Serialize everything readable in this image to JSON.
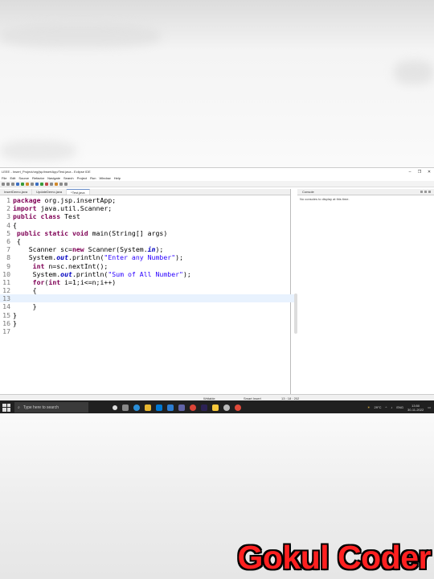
{
  "window": {
    "title": "LEEE - Insert_Project/org/jsp/insertApp/Test.java - Eclipse IDE",
    "controls": [
      "–",
      "❐",
      "✕"
    ]
  },
  "menu": [
    "File",
    "Edit",
    "Source",
    "Refactor",
    "Navigate",
    "Search",
    "Project",
    "Run",
    "Window",
    "Help"
  ],
  "editor_tabs": [
    {
      "label": "InsertDemo.java",
      "active": false
    },
    {
      "label": "UpdateDemo.java",
      "active": false
    },
    {
      "label": "*Test.java",
      "active": true
    }
  ],
  "code_lines": [
    {
      "n": "1",
      "tokens": [
        {
          "t": "package",
          "c": "kw"
        },
        {
          "t": " org.jsp.insertApp;",
          "c": ""
        }
      ]
    },
    {
      "n": "2",
      "tokens": [
        {
          "t": "import",
          "c": "kw"
        },
        {
          "t": " java.util.Scanner;",
          "c": ""
        }
      ]
    },
    {
      "n": "3",
      "tokens": [
        {
          "t": "public class",
          "c": "kw"
        },
        {
          "t": " Test",
          "c": ""
        }
      ]
    },
    {
      "n": "4",
      "tokens": [
        {
          "t": "{",
          "c": ""
        }
      ]
    },
    {
      "n": "5",
      "tokens": [
        {
          "t": " public static void",
          "c": "kw"
        },
        {
          "t": " main(String[] args)",
          "c": ""
        }
      ]
    },
    {
      "n": "6",
      "tokens": [
        {
          "t": " {",
          "c": ""
        }
      ]
    },
    {
      "n": "7",
      "tokens": [
        {
          "t": "    Scanner sc=",
          "c": ""
        },
        {
          "t": "new",
          "c": "kw"
        },
        {
          "t": " Scanner(System.",
          "c": ""
        },
        {
          "t": "in",
          "c": "fld"
        },
        {
          "t": ");",
          "c": ""
        }
      ]
    },
    {
      "n": "8",
      "tokens": [
        {
          "t": "    System.",
          "c": ""
        },
        {
          "t": "out",
          "c": "fld"
        },
        {
          "t": ".println(",
          "c": ""
        },
        {
          "t": "\"Enter any Number\"",
          "c": "str"
        },
        {
          "t": ");",
          "c": ""
        }
      ]
    },
    {
      "n": "9",
      "tokens": [
        {
          "t": "     ",
          "c": ""
        },
        {
          "t": "int",
          "c": "kw"
        },
        {
          "t": " n=sc.nextInt();",
          "c": ""
        }
      ]
    },
    {
      "n": "10",
      "tokens": [
        {
          "t": "     System.",
          "c": ""
        },
        {
          "t": "out",
          "c": "fld"
        },
        {
          "t": ".println(",
          "c": ""
        },
        {
          "t": "\"Sum of All Number\"",
          "c": "str"
        },
        {
          "t": ");",
          "c": ""
        }
      ]
    },
    {
      "n": "11",
      "tokens": [
        {
          "t": "     ",
          "c": ""
        },
        {
          "t": "for",
          "c": "kw"
        },
        {
          "t": "(",
          "c": ""
        },
        {
          "t": "int",
          "c": "kw"
        },
        {
          "t": " i=1;i<=n;i++)",
          "c": ""
        }
      ]
    },
    {
      "n": "12",
      "tokens": [
        {
          "t": "     {",
          "c": ""
        }
      ]
    },
    {
      "n": "13",
      "tokens": [
        {
          "t": "",
          "c": ""
        }
      ],
      "current": true
    },
    {
      "n": "14",
      "tokens": [
        {
          "t": "     }",
          "c": ""
        }
      ]
    },
    {
      "n": "15",
      "tokens": [
        {
          "t": "}",
          "c": ""
        }
      ]
    },
    {
      "n": "16",
      "tokens": [
        {
          "t": "}",
          "c": ""
        }
      ]
    },
    {
      "n": "17",
      "tokens": [
        {
          "t": "",
          "c": ""
        }
      ]
    }
  ],
  "console": {
    "tab_label": "Console",
    "message": "No consoles to display at this time."
  },
  "status": {
    "writable": "Writable",
    "insert_mode": "Smart Insert",
    "position": "13 : 18 : 202"
  },
  "taskbar": {
    "search_placeholder": "Type here to search",
    "weather": "29°C",
    "lang": "ENG",
    "time": "13:50",
    "date": "30-11-2022"
  },
  "watermark": "Gokul Coder",
  "colors": {
    "keyword": "#7f0055",
    "string": "#2a00ff",
    "field": "#0000c0",
    "brand": "#ff2020"
  }
}
